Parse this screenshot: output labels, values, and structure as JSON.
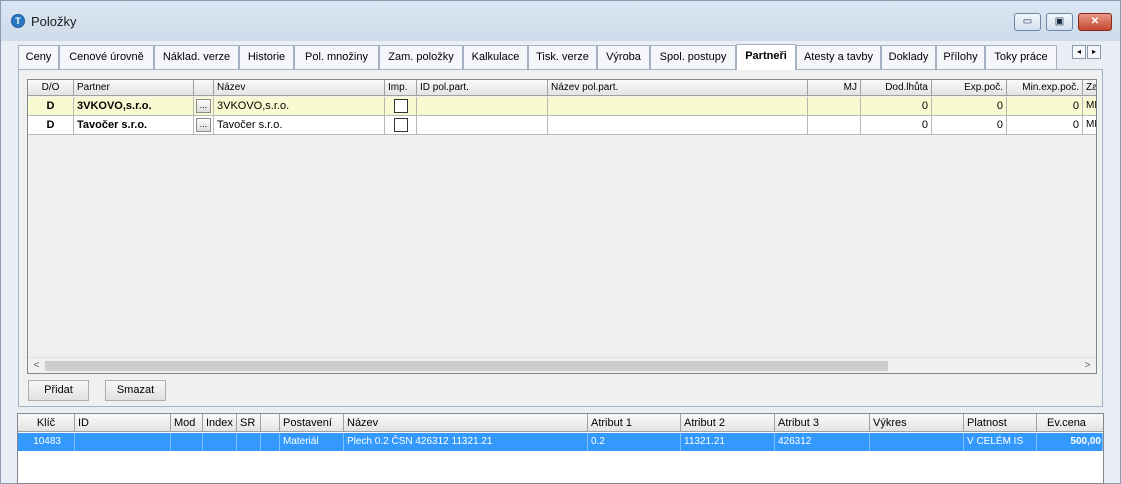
{
  "window": {
    "title": "Položky",
    "app_icon_glyph": "T",
    "icons": {
      "app": "app-icon",
      "minimize": "minimize-icon",
      "maximize": "maximize-icon",
      "close": "close-icon"
    },
    "controls": {
      "minimize": "▭",
      "maximize": "▣",
      "close": "✕"
    },
    "close_color": "#c4452f"
  },
  "tabs": [
    {
      "label": "Ceny"
    },
    {
      "label": "Cenové úrovně"
    },
    {
      "label": "Náklad. verze"
    },
    {
      "label": "Historie"
    },
    {
      "label": "Pol. množiny"
    },
    {
      "label": "Zam. položky"
    },
    {
      "label": "Kalkulace"
    },
    {
      "label": "Tisk. verze"
    },
    {
      "label": "Výroba"
    },
    {
      "label": "Spol. postupy"
    },
    {
      "label": "Partneři"
    },
    {
      "label": "Atesty a tavby"
    },
    {
      "label": "Doklady"
    },
    {
      "label": "Přílohy"
    },
    {
      "label": "Toky práce"
    }
  ],
  "active_tab": "Partneři",
  "tab_scroll": {
    "left": "◂",
    "right": "▸"
  },
  "partners_grid": {
    "columns": [
      "D/O",
      "Partner",
      "",
      "Název",
      "Imp.",
      "ID pol.part.",
      "Název pol.part.",
      "MJ",
      "Dod.lhůta",
      "Exp.poč.",
      "Min.exp.poč.",
      "Za"
    ],
    "rows": [
      {
        "do": "D",
        "partner": "3VKOVO,s.r.o.",
        "lookup": "...",
        "nazev": "3VKOVO,s.r.o.",
        "imp": false,
        "id_pol_part": "",
        "nazev_pol_part": "",
        "mj": "",
        "dod_lhuta": "0",
        "exp_poc": "0",
        "min_exp_poc": "0",
        "za": "ME",
        "selected": true
      },
      {
        "do": "D",
        "partner": "Tavočer s.r.o.",
        "lookup": "...",
        "nazev": "Tavočer s.r.o.",
        "imp": false,
        "id_pol_part": "",
        "nazev_pol_part": "",
        "mj": "",
        "dod_lhuta": "0",
        "exp_poc": "0",
        "min_exp_poc": "0",
        "za": "ME",
        "selected": false
      }
    ],
    "row_highlight_color": "#fafad2",
    "scroll_arrows": {
      "left": "<",
      "right": ">"
    }
  },
  "buttons": {
    "add": "Přidat",
    "delete": "Smazat"
  },
  "items_grid": {
    "columns": [
      "Klíč",
      "ID",
      "Mod",
      "Index",
      "SR",
      "",
      "Postavení",
      "Název",
      "Atribut 1",
      "Atribut 2",
      "Atribut 3",
      "Výkres",
      "Platnost",
      "Ev.cena"
    ],
    "rows": [
      {
        "klic": "10483",
        "id": "",
        "mod": "",
        "index": "",
        "sr": "",
        "x": "",
        "postaveni": "Materiál",
        "nazev": "Plech 0.2 ČSN 426312 11321.21",
        "atribut1": "0.2",
        "atribut2": "11321.21",
        "atribut3": "426312",
        "vykres": "",
        "platnost": "V CELÉM IS",
        "ev_cena": "500,00"
      }
    ],
    "selection_color": "#3399ff"
  }
}
